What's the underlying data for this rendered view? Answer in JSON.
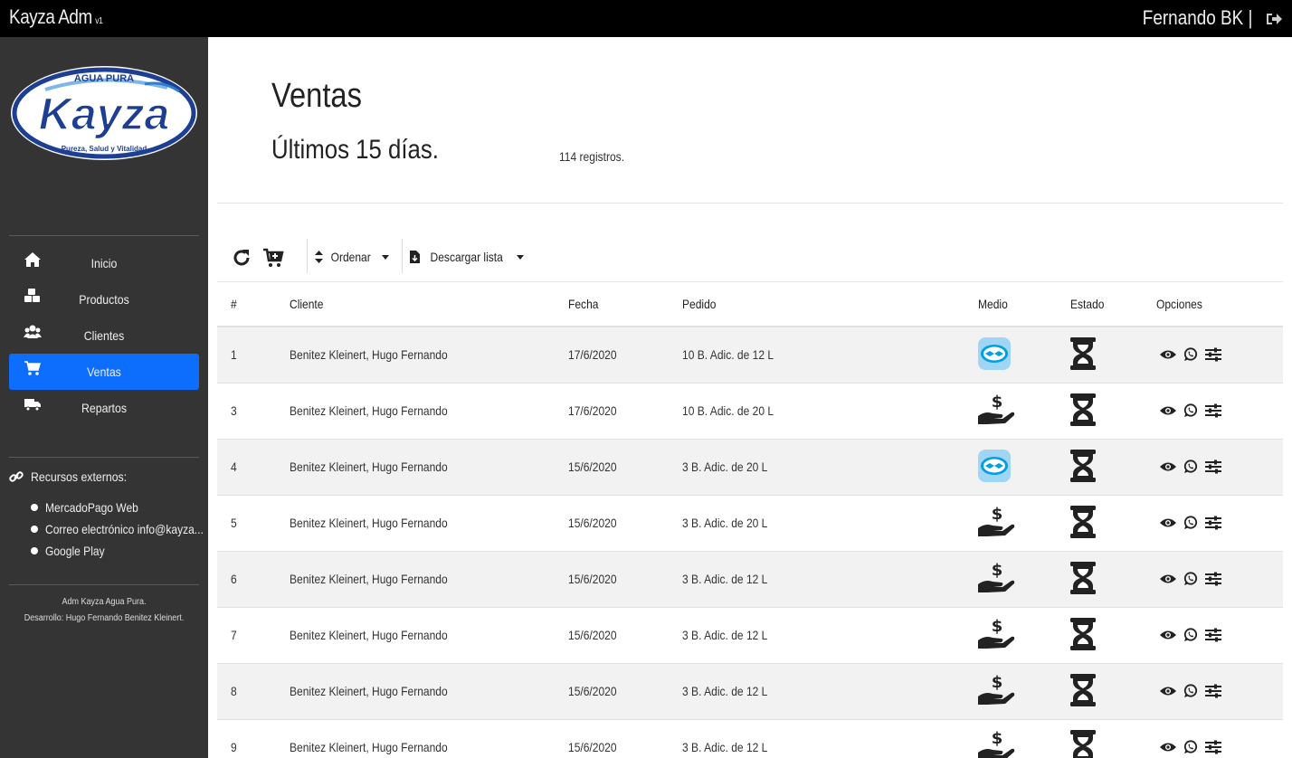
{
  "app": {
    "title": "Kayza Adm",
    "version": "v1",
    "user": "Fernando BK |"
  },
  "logo": {
    "top": "AGUA PURA",
    "name": "Kayza",
    "tagline": "Pureza, Salud y Vitalidad"
  },
  "nav": [
    {
      "label": "Inicio",
      "icon": "home-icon"
    },
    {
      "label": "Productos",
      "icon": "cubes-icon"
    },
    {
      "label": "Clientes",
      "icon": "users-icon"
    },
    {
      "label": "Ventas",
      "icon": "cart-icon",
      "active": true
    },
    {
      "label": "Repartos",
      "icon": "truck-icon"
    }
  ],
  "resources": {
    "title": "Recursos externos:",
    "items": [
      "MercadoPago Web",
      "Correo electrónico info@kayza...",
      "Google Play"
    ]
  },
  "footer": {
    "line1": "Adm Kayza Agua Pura.",
    "line2": "Desarrollo: Hugo Fernando Benitez Kleinert."
  },
  "page": {
    "title": "Ventas",
    "subtitle": "Últimos 15 días.",
    "count": "114 registros."
  },
  "toolbar": {
    "order_label": "Ordenar",
    "download_label": "Descargar lista"
  },
  "table": {
    "headers": [
      "#",
      "Cliente",
      "Fecha",
      "Pedido",
      "Medio",
      "Estado",
      "Opciones"
    ],
    "rows": [
      {
        "id": "1",
        "cliente": "Benitez Kleinert, Hugo Fernando",
        "fecha": "17/6/2020",
        "pedido": "10 B. Adic. de 12 L",
        "medio": "mercadopago",
        "estado": "pendiente"
      },
      {
        "id": "3",
        "cliente": "Benitez Kleinert, Hugo Fernando",
        "fecha": "17/6/2020",
        "pedido": "10 B. Adic. de 20 L",
        "medio": "efectivo",
        "estado": "pendiente"
      },
      {
        "id": "4",
        "cliente": "Benitez Kleinert, Hugo Fernando",
        "fecha": "15/6/2020",
        "pedido": "3 B. Adic. de 20 L",
        "medio": "mercadopago",
        "estado": "pendiente"
      },
      {
        "id": "5",
        "cliente": "Benitez Kleinert, Hugo Fernando",
        "fecha": "15/6/2020",
        "pedido": "3 B. Adic. de 20 L",
        "medio": "efectivo",
        "estado": "pendiente"
      },
      {
        "id": "6",
        "cliente": "Benitez Kleinert, Hugo Fernando",
        "fecha": "15/6/2020",
        "pedido": "3 B. Adic. de 12 L",
        "medio": "efectivo",
        "estado": "pendiente"
      },
      {
        "id": "7",
        "cliente": "Benitez Kleinert, Hugo Fernando",
        "fecha": "15/6/2020",
        "pedido": "3 B. Adic. de 12 L",
        "medio": "efectivo",
        "estado": "pendiente"
      },
      {
        "id": "8",
        "cliente": "Benitez Kleinert, Hugo Fernando",
        "fecha": "15/6/2020",
        "pedido": "3 B. Adic. de 12 L",
        "medio": "efectivo",
        "estado": "pendiente"
      },
      {
        "id": "9",
        "cliente": "Benitez Kleinert, Hugo Fernando",
        "fecha": "15/6/2020",
        "pedido": "3 B. Adic. de 12 L",
        "medio": "efectivo",
        "estado": "pendiente"
      }
    ]
  },
  "colors": {
    "accent": "#0d6efd",
    "sidebar": "#343434",
    "topbar": "#000000",
    "logo_blue": "#1d3f93",
    "mp_blue": "#009ee3"
  }
}
